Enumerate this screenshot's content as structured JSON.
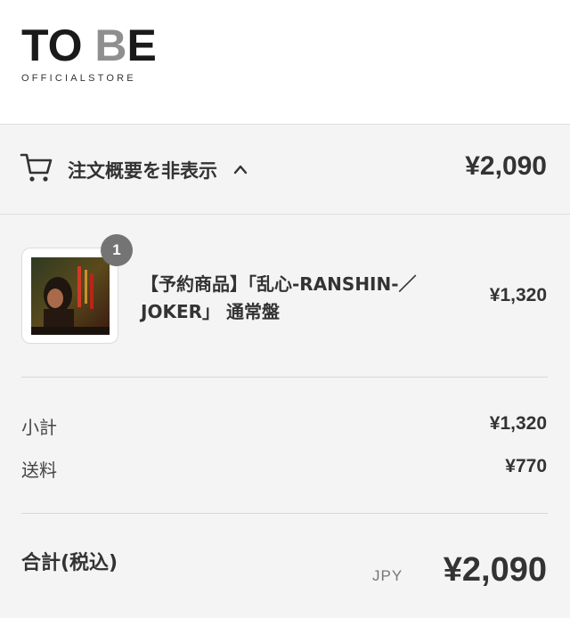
{
  "header": {
    "logo_main_dark": "TO ",
    "logo_main_light": "B",
    "logo_main_end": "E",
    "logo_sub": "OFFICIALSTORE"
  },
  "summary_toggle": {
    "cart_icon": "cart-icon",
    "label": "注文概要を非表示",
    "chevron_icon": "chevron-up-icon",
    "total": "¥2,090"
  },
  "line_item": {
    "quantity": "1",
    "title": "【予約商品】「乱心-RANSHIN-／JOKER」 通常盤",
    "price": "¥1,320"
  },
  "costs": {
    "subtotal_label": "小計",
    "subtotal_value": "¥1,320",
    "shipping_label": "送料",
    "shipping_value": "¥770"
  },
  "total": {
    "label": "合計(税込)",
    "currency": "JPY",
    "value": "¥2,090"
  },
  "colors": {
    "background": "#f4f4f4",
    "header_bg": "#ffffff",
    "text": "#333333",
    "badge": "#747474"
  }
}
